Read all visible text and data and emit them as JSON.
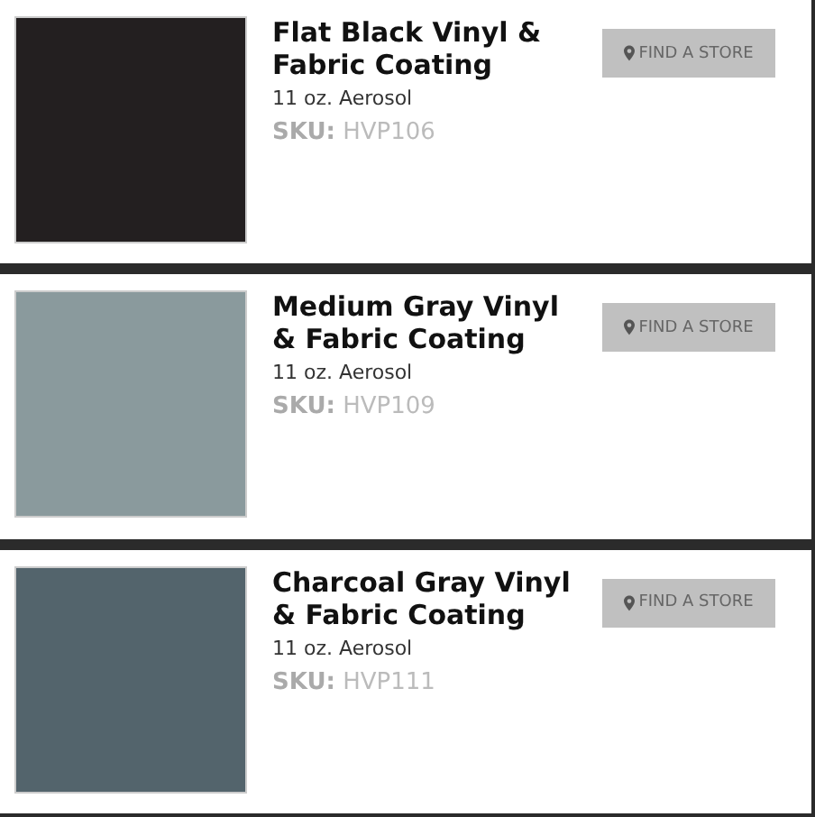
{
  "products": [
    {
      "title": "Flat Black Vinyl & Fabric Coating",
      "size": "11 oz. Aerosol",
      "sku": "**SKU:** HVP106",
      "color": "#231f20",
      "button": "FIND A STORE"
    },
    {
      "title": "Medium Gray Vinyl & Fabric Coating",
      "size": "11 oz. Aerosol",
      "sku": "**SKU:** HVP109",
      "color": "#8a9a9d",
      "button": "FIND A STORE"
    },
    {
      "title": "Charcoal Gray Vinyl & Fabric Coating",
      "size": "11 oz. Aerosol",
      "sku": "**SKU:** HVP111",
      "color": "#53646c",
      "button": "FIND A STORE"
    }
  ]
}
